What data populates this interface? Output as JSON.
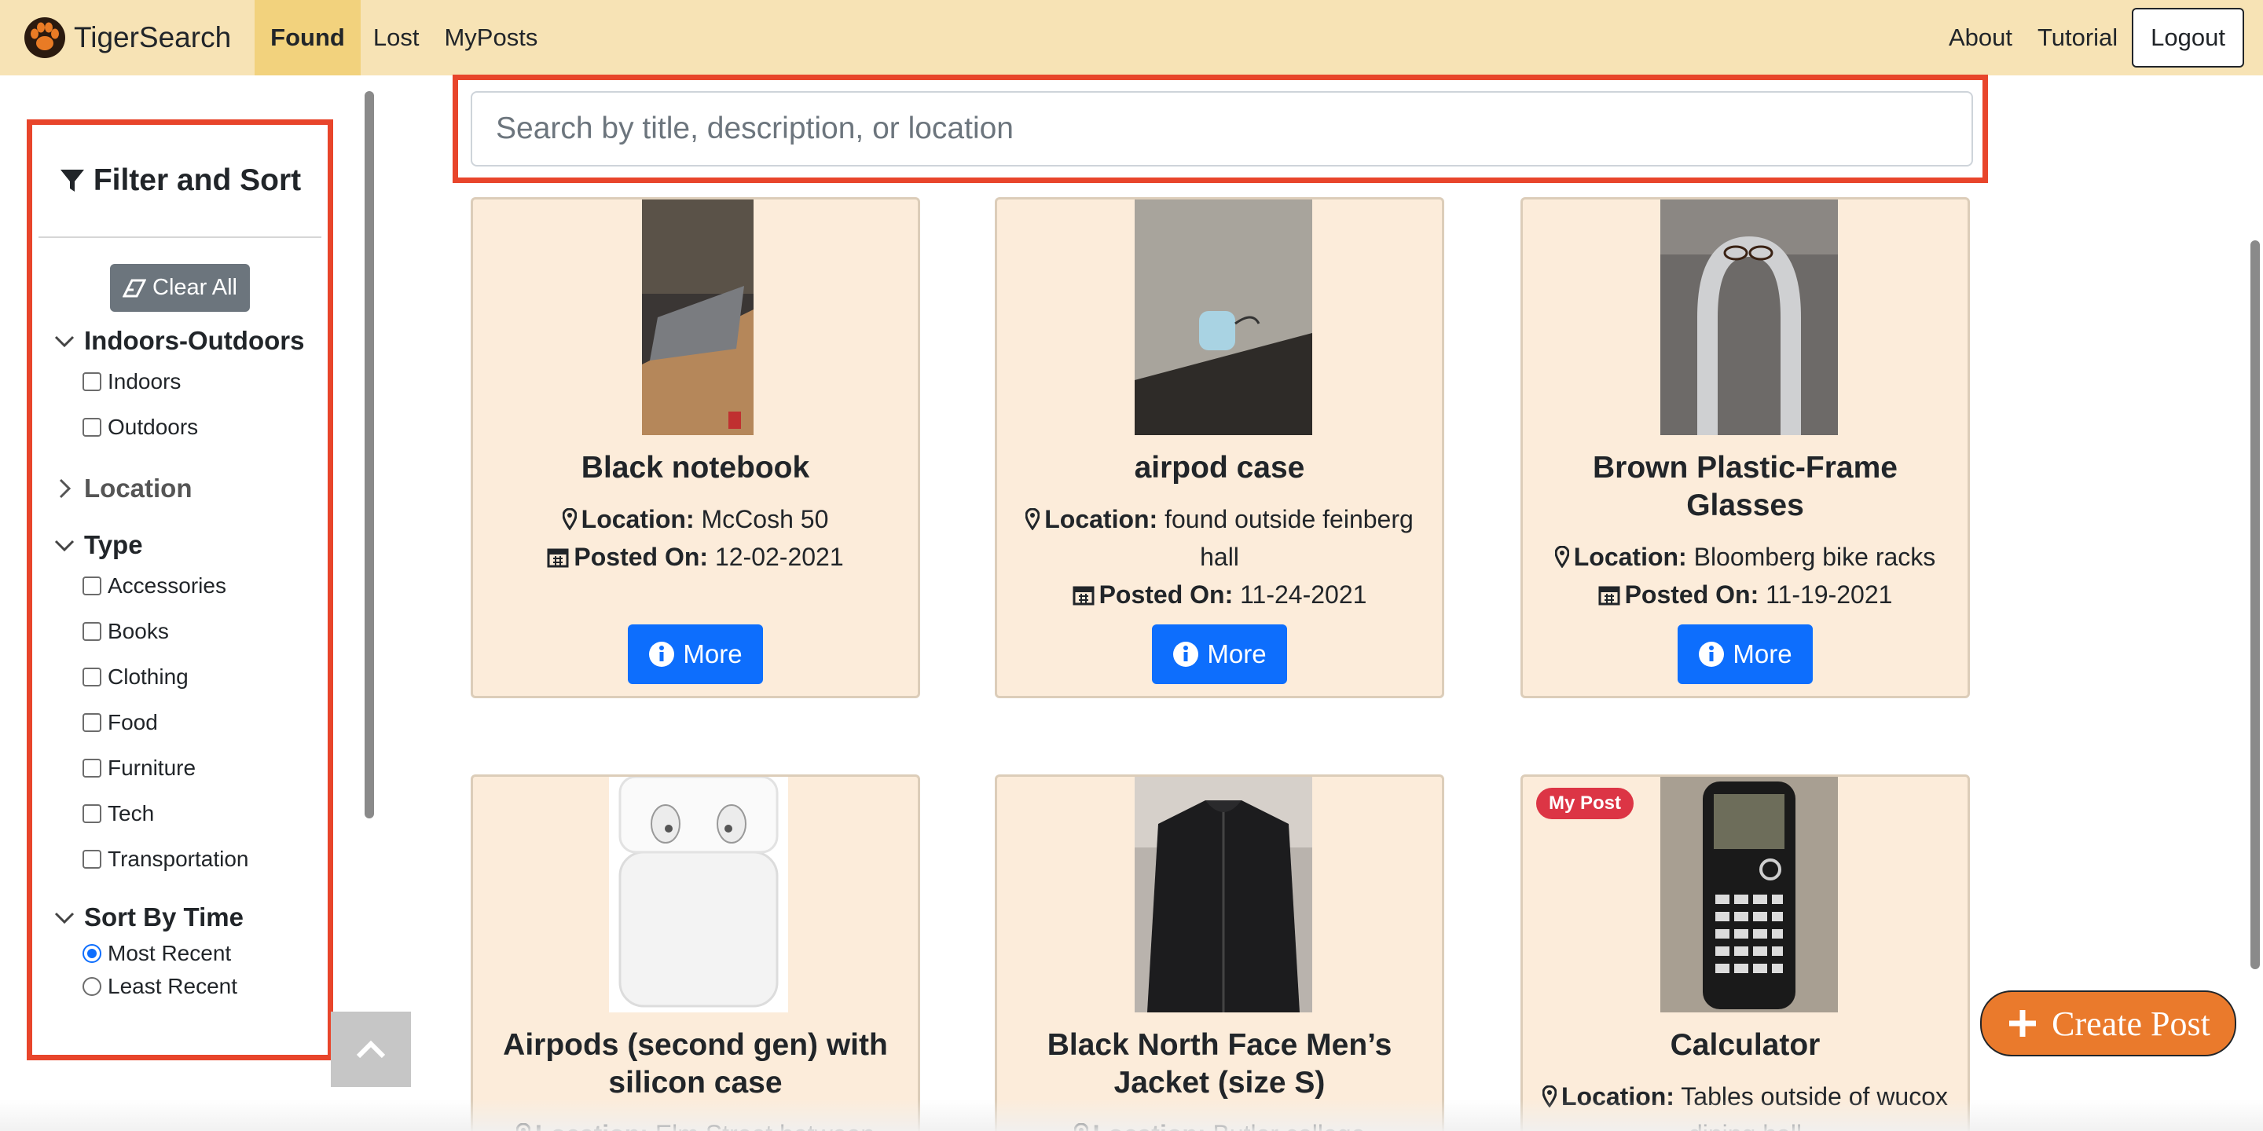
{
  "navbar": {
    "brand": "TigerSearch",
    "brand_icon": "paw-icon",
    "links": [
      "Found",
      "Lost",
      "MyPosts"
    ],
    "active": "Found",
    "right_links": [
      "About",
      "Tutorial"
    ],
    "logout": "Logout"
  },
  "sidebar": {
    "title": "Filter and Sort",
    "clear_all": "Clear All",
    "indoors_outdoors": {
      "label": "Indoors-Outdoors",
      "options": [
        "Indoors",
        "Outdoors"
      ]
    },
    "location": {
      "label": "Location",
      "collapsed": true
    },
    "type": {
      "label": "Type",
      "options": [
        "Accessories",
        "Books",
        "Clothing",
        "Food",
        "Furniture",
        "Tech",
        "Transportation"
      ]
    },
    "sort": {
      "label": "Sort By Time",
      "options": [
        "Most Recent",
        "Least Recent"
      ],
      "selected": "Most Recent"
    }
  },
  "search": {
    "placeholder": "Search by title, description, or location"
  },
  "labels": {
    "location": "Location:",
    "posted_on": "Posted On:",
    "more": "More",
    "my_post": "My Post"
  },
  "cards": [
    {
      "title": "Black notebook",
      "location": "McCosh 50",
      "posted_on": "12-02-2021"
    },
    {
      "title": "airpod case",
      "location_line1": "found outside feinberg",
      "location_line2": "hall",
      "posted_on": "11-24-2021"
    },
    {
      "title_line1": "Brown Plastic-Frame",
      "title_line2": "Glasses",
      "location": "Bloomberg bike racks",
      "posted_on": "11-19-2021"
    },
    {
      "title_line1": "Airpods (second gen) with",
      "title_line2": "silicon case",
      "location": "Elm Street between"
    },
    {
      "title_line1": "Black North Face Men’s",
      "title_line2": "Jacket (size S)",
      "location": "Butler college"
    },
    {
      "title": "Calculator",
      "location_line1": "Tables outside of wucox",
      "location_line2": "dining hall",
      "my_post": true
    }
  ],
  "create_post": "Create Post",
  "colors": {
    "navbar": "#f7e3b5",
    "active_tab": "#f2d27d",
    "card_bg": "#fcecda",
    "primary": "#0d6efd",
    "highlight": "#e8452b",
    "create_post": "#ea7a2c",
    "badge": "#dc3545"
  }
}
